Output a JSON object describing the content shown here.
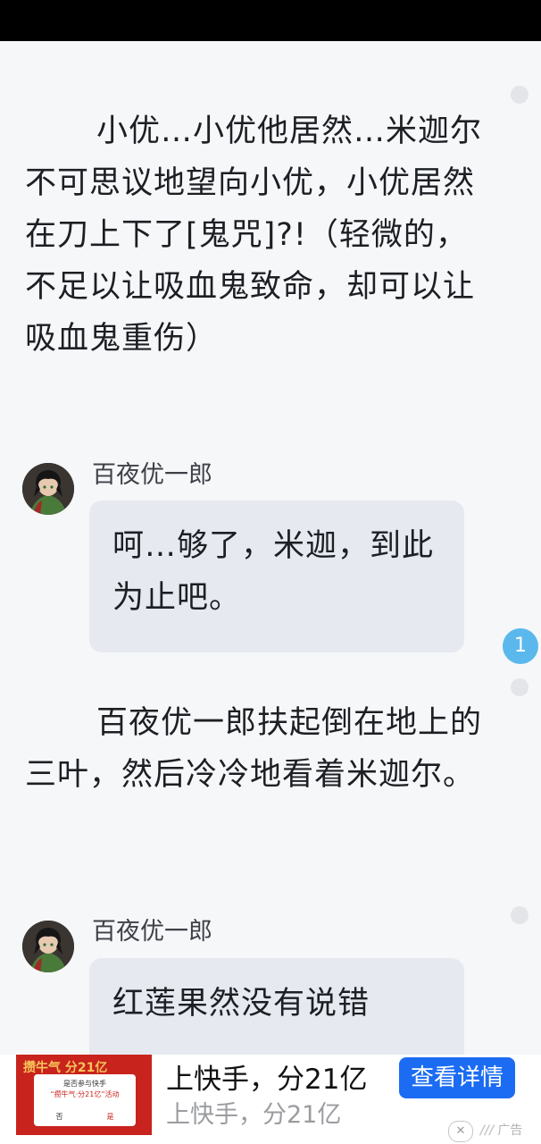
{
  "paragraphs": [
    "小优…小优他居然…米迦尔不可思议地望向小优，小优居然在刀上下了[鬼咒]?!（轻微的，不足以让吸血鬼致命，却可以让吸血鬼重伤）",
    "百夜优一郎扶起倒在地上的三叶，然后冷冷地看着米迦尔。"
  ],
  "dialogues": [
    {
      "speaker": "百夜优一郎",
      "text": "呵…够了，米迦，到此为止吧。"
    },
    {
      "speaker": "百夜优一郎",
      "text": "红莲果然没有说错"
    }
  ],
  "comment_badge": "1",
  "ad": {
    "title": "上快手，分21亿",
    "subtitle": "上快手，分21亿",
    "button": "查看详情",
    "label": "广告",
    "thumb_header": "攒牛气 分21亿",
    "thumb_line1": "是否参与快手",
    "thumb_line2": "“攒牛气·分21亿”活动",
    "thumb_no": "否",
    "thumb_yes": "是"
  },
  "icons": [
    "close-icon",
    "ad-logo-icon",
    "avatar-image"
  ]
}
